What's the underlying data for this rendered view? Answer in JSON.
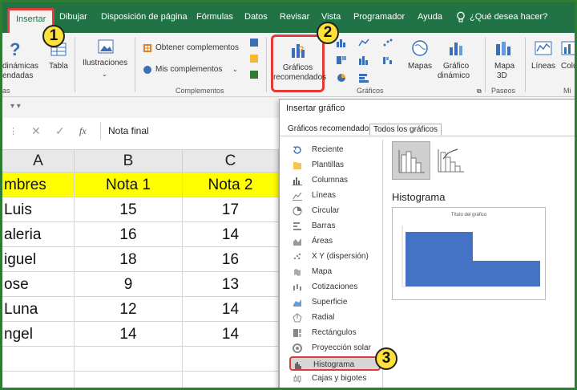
{
  "ribbon_tabs": [
    "Insertar",
    "Dibujar",
    "Disposición de página",
    "Fórmulas",
    "Datos",
    "Revisar",
    "Vista",
    "Programador",
    "Ayuda"
  ],
  "search_label": "¿Qué desea hacer?",
  "ribbon": {
    "dinamicas": "dinámicas",
    "endadas": "endadas",
    "tabla": "Tabla",
    "as": "as",
    "ilustraciones": "Ilustraciones",
    "obtener": "Obtener complementos",
    "mis": "Mis complementos",
    "complementos_group": "Complementos",
    "graficos_rec_1": "Gráficos",
    "graficos_rec_2": "recomendados",
    "graficos_group": "Gráficos",
    "mapas": "Mapas",
    "grafico_din_1": "Gráfico",
    "grafico_din_2": "dinámico",
    "mapa3d_1": "Mapa",
    "mapa3d_2": "3D",
    "paseos_group": "Paseos",
    "lineas": "Líneas",
    "colu": "Colu",
    "mini": "Mi"
  },
  "badges": [
    "1",
    "2",
    "3"
  ],
  "formula": {
    "value": "Nota final",
    "fx": "fx"
  },
  "sheet": {
    "columns": [
      "A",
      "B",
      "C"
    ],
    "header": [
      "mbres",
      "Nota 1",
      "Nota 2"
    ],
    "rows": [
      [
        "Luis",
        "15",
        "17"
      ],
      [
        "aleria",
        "16",
        "14"
      ],
      [
        "iguel",
        "18",
        "16"
      ],
      [
        "ose",
        "9",
        "13"
      ],
      [
        "Luna",
        "12",
        "14"
      ],
      [
        "ngel",
        "14",
        "14"
      ]
    ]
  },
  "dialog": {
    "title": "Insertar gráfico",
    "tabs": [
      "Gráficos recomendados",
      "Todos los gráficos"
    ],
    "selected_tab": "Todos los gráficos",
    "chart_types": [
      "Reciente",
      "Plantillas",
      "Columnas",
      "Líneas",
      "Circular",
      "Barras",
      "Áreas",
      "X Y (dispersión)",
      "Mapa",
      "Cotizaciones",
      "Superficie",
      "Radial",
      "Rectángulos",
      "Proyección solar",
      "Histograma",
      "Cajas y bigotes"
    ],
    "selected_type": "Histograma",
    "preview_heading": "Histograma",
    "preview_chart_title": "Título del gráfico"
  },
  "colors": {
    "ribbon_green": "#217346",
    "highlight_red": "#e53935",
    "badge_yellow": "#fde03a",
    "header_yellow": "#ffff00",
    "bar_blue": "#4472c4"
  },
  "icons": {
    "help": "question-icon",
    "search": "lightbulb-icon",
    "dialog_list": [
      "recent-icon",
      "templates-icon",
      "column-chart-icon",
      "line-chart-icon",
      "pie-chart-icon",
      "bar-chart-icon",
      "area-chart-icon",
      "scatter-chart-icon",
      "map-chart-icon",
      "stock-chart-icon",
      "surface-chart-icon",
      "radar-chart-icon",
      "treemap-chart-icon",
      "sunburst-chart-icon",
      "histogram-chart-icon",
      "box-whisker-chart-icon"
    ]
  }
}
